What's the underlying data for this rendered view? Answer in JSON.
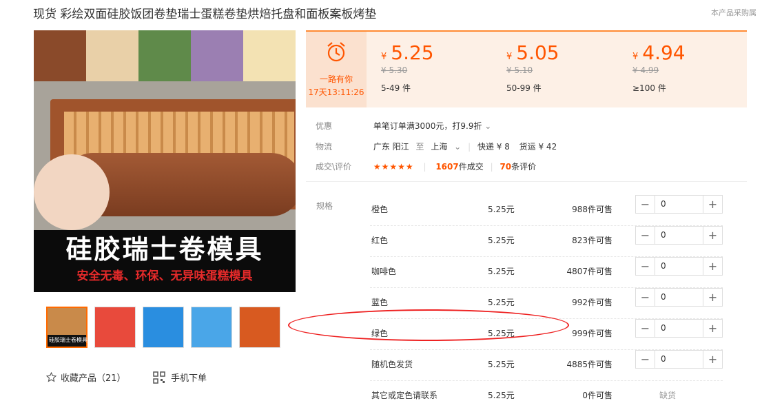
{
  "title": "现货 彩绘双面硅胶饭团卷垫瑞士蛋糕卷垫烘焙托盘和面板案板烤垫",
  "corner_note": "本产品采购属",
  "image": {
    "banner_main": "硅胶瑞士卷模具",
    "banner_sub": "安全无毒、环保、无异味蛋糕模具",
    "thumb_label": "硅胶瑞士卷模具"
  },
  "actions": {
    "favorite": "收藏产品（21）",
    "mobile_order": "手机下单"
  },
  "promo": {
    "label": "一路有你",
    "countdown": "17天13:11:26"
  },
  "tiers": [
    {
      "currency": "¥",
      "price": "5.25",
      "original": "¥ 5.30",
      "qty": "5-49 件"
    },
    {
      "currency": "¥",
      "price": "5.05",
      "original": "¥ 5.10",
      "qty": "50-99 件"
    },
    {
      "currency": "¥",
      "price": "4.94",
      "original": "¥ 4.99",
      "qty": "≥100 件"
    }
  ],
  "discount": {
    "label": "优惠",
    "value": "单笔订单满3000元，打9.9折"
  },
  "logistics": {
    "label": "物流",
    "from": "广东 阳江",
    "to_word": "至",
    "to": "上海",
    "express": "快递 ¥ 8",
    "freight": "货运 ¥ 42"
  },
  "reviews": {
    "label": "成交\\评价",
    "stars": "★★★★★",
    "sold_count": "1607",
    "sold_text": "件成交",
    "review_count": "70",
    "review_text": "条评价"
  },
  "spec_label": "规格",
  "specs": [
    {
      "name": "橙色",
      "price": "5.25元",
      "stock": "988件可售",
      "qty": "0"
    },
    {
      "name": "红色",
      "price": "5.25元",
      "stock": "823件可售",
      "qty": "0"
    },
    {
      "name": "咖啡色",
      "price": "5.25元",
      "stock": "4807件可售",
      "qty": "0"
    },
    {
      "name": "蓝色",
      "price": "5.25元",
      "stock": "992件可售",
      "qty": "0"
    },
    {
      "name": "绿色",
      "price": "5.25元",
      "stock": "999件可售",
      "qty": "0"
    },
    {
      "name": "随机色发货",
      "price": "5.25元",
      "stock": "4885件可售",
      "qty": "0"
    },
    {
      "name": "其它或定色请联系",
      "price": "5.25元",
      "stock": "0件可售",
      "status": "缺货"
    }
  ],
  "colors": {
    "accent": "#ff5500",
    "highlight_circle": "#e22222"
  }
}
